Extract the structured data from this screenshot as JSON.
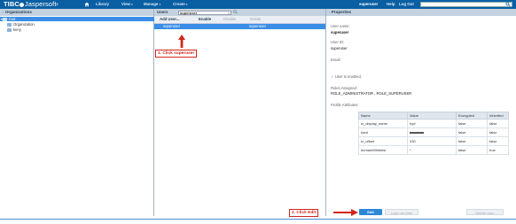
{
  "header": {
    "logo_a": "TIBC",
    "logo_b": "Jaspersoft",
    "logo_reg": "®",
    "nav": [
      {
        "label": "Library"
      },
      {
        "label": "View"
      },
      {
        "label": "Manage"
      },
      {
        "label": "Create"
      }
    ],
    "caret": "▾",
    "username": "superuser",
    "help": "Help",
    "logout": "Log Out",
    "search_value": ""
  },
  "organizations": {
    "title": "Organizations",
    "tree": [
      {
        "label": "root"
      },
      {
        "label": "Organization"
      },
      {
        "label": "keny"
      }
    ]
  },
  "users": {
    "label": "Users",
    "search_value": "superuser",
    "clear_glyph": "×",
    "toolbar": {
      "add": "Add User...",
      "enable": "Enable",
      "disable": "Disable",
      "delete": "Delete"
    },
    "rows": [
      {
        "name": "superuser",
        "id": "superuser"
      }
    ]
  },
  "callouts": {
    "step1": "1. Click superuser",
    "step2": "2. Click Edit"
  },
  "properties": {
    "title": "Properties",
    "user_name_label": "User name:",
    "user_name": "superuser",
    "user_id_label": "User ID:",
    "user_id": "superuser",
    "email_label": "Email:",
    "email": "",
    "enabled_check": "✓",
    "enabled_label": "User is enabled.",
    "roles_label": "Roles Assigned:",
    "roles": "ROLE_ADMINISTRATOR , ROLE_SUPERUSER",
    "profile_label": "Profile Attributes:",
    "table": {
      "headers": [
        "Name",
        "Value",
        "Encrypted",
        "Inherited"
      ],
      "rows": [
        {
          "name": "tz_display_name",
          "value": "hyd",
          "encrypted": "false",
          "inherited": "false"
        },
        {
          "name": "hard",
          "value": "",
          "encrypted": "false",
          "inherited": "false"
        },
        {
          "name": "tz_offset",
          "value": "330",
          "encrypted": "false",
          "inherited": "false"
        },
        {
          "name": "domainWhitelist",
          "value": "*",
          "encrypted": "false",
          "inherited": "true"
        }
      ]
    },
    "buttons": {
      "edit": "Edit",
      "login_as": "Login as User",
      "delete": "Delete User"
    }
  },
  "colors": {
    "topbar": "#0a5fa3",
    "selection": "#3a8ee6",
    "callout": "#d0261b",
    "edit_button": "#2c87d8"
  }
}
